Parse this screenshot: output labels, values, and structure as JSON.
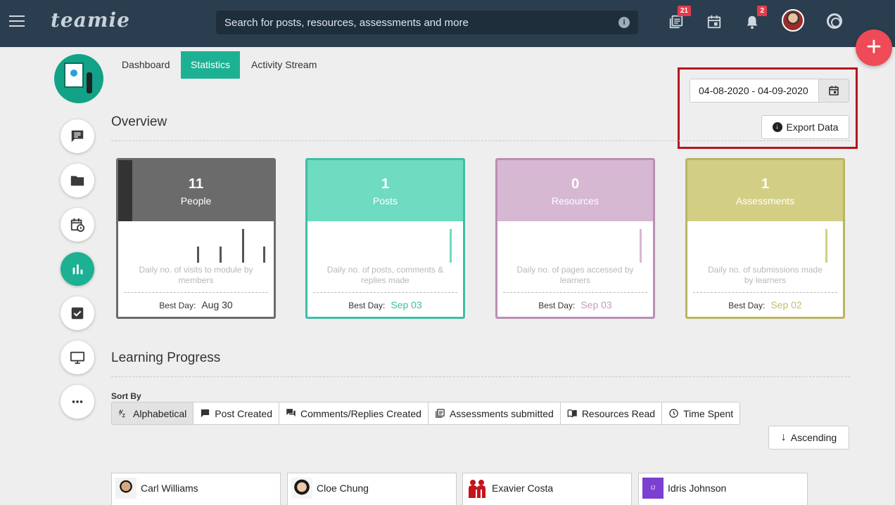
{
  "topbar": {
    "logo": "teamie",
    "search_placeholder": "Search for posts, resources, assessments and more",
    "library_badge": "21",
    "notification_badge": "2",
    "fab_label": "+"
  },
  "tabs": [
    {
      "label": "Dashboard",
      "active": false
    },
    {
      "label": "Statistics",
      "active": true
    },
    {
      "label": "Activity Stream",
      "active": false
    }
  ],
  "date_range": {
    "value": "04-08-2020 - 04-09-2020",
    "export_label": "Export Data"
  },
  "overview": {
    "title": "Overview",
    "cards": [
      {
        "number": "11",
        "label": "People",
        "caption": "Daily no. of visits to module by members",
        "best_day_label": "Best Day:",
        "best_day": "Aug 30",
        "color": "#6b6b6b",
        "border": "#6b6b6b",
        "best_color": "#333333",
        "bar_levels": [
          0.45,
          0.45,
          0.95,
          0.45
        ]
      },
      {
        "number": "1",
        "label": "Posts",
        "caption": "Daily no. of posts, comments & replies made",
        "best_day_label": "Best Day:",
        "best_day": "Sep 03",
        "color": "#6fdbc1",
        "border": "#3dbfa3",
        "best_color": "#3dbfa3",
        "bar_levels": [
          0.95
        ]
      },
      {
        "number": "0",
        "label": "Resources",
        "caption": "Daily no. of pages accessed by learners",
        "best_day_label": "Best Day:",
        "best_day": "Sep 03",
        "color": "#d6b8d2",
        "border": "#b98fb4",
        "best_color": "#c79bc1",
        "bar_levels": [
          0.95
        ]
      },
      {
        "number": "1",
        "label": "Assessments",
        "caption": "Daily no. of submissions made by learners",
        "best_day_label": "Best Day:",
        "best_day": "Sep 02",
        "color": "#d2cf85",
        "border": "#b9b563",
        "best_color": "#c1be6e",
        "bar_levels": [
          0.95
        ]
      }
    ]
  },
  "learning_progress": {
    "title": "Learning Progress",
    "sort_by_label": "Sort By",
    "sort_options": [
      {
        "label": "Alphabetical",
        "icon": "az-sort-icon",
        "active": true
      },
      {
        "label": "Post Created",
        "icon": "comment-icon",
        "active": false
      },
      {
        "label": "Comments/Replies Created",
        "icon": "comments-icon",
        "active": false
      },
      {
        "label": "Assessments submitted",
        "icon": "assessment-icon",
        "active": false
      },
      {
        "label": "Resources Read",
        "icon": "book-icon",
        "active": false
      },
      {
        "label": "Time Spent",
        "icon": "clock-icon",
        "active": false
      }
    ],
    "order_label": "Ascending",
    "people": [
      {
        "name": "Carl Williams"
      },
      {
        "name": "Cloe Chung"
      },
      {
        "name": "Exavier Costa"
      },
      {
        "name": "Idris Johnson",
        "initials": "IJ"
      }
    ]
  }
}
